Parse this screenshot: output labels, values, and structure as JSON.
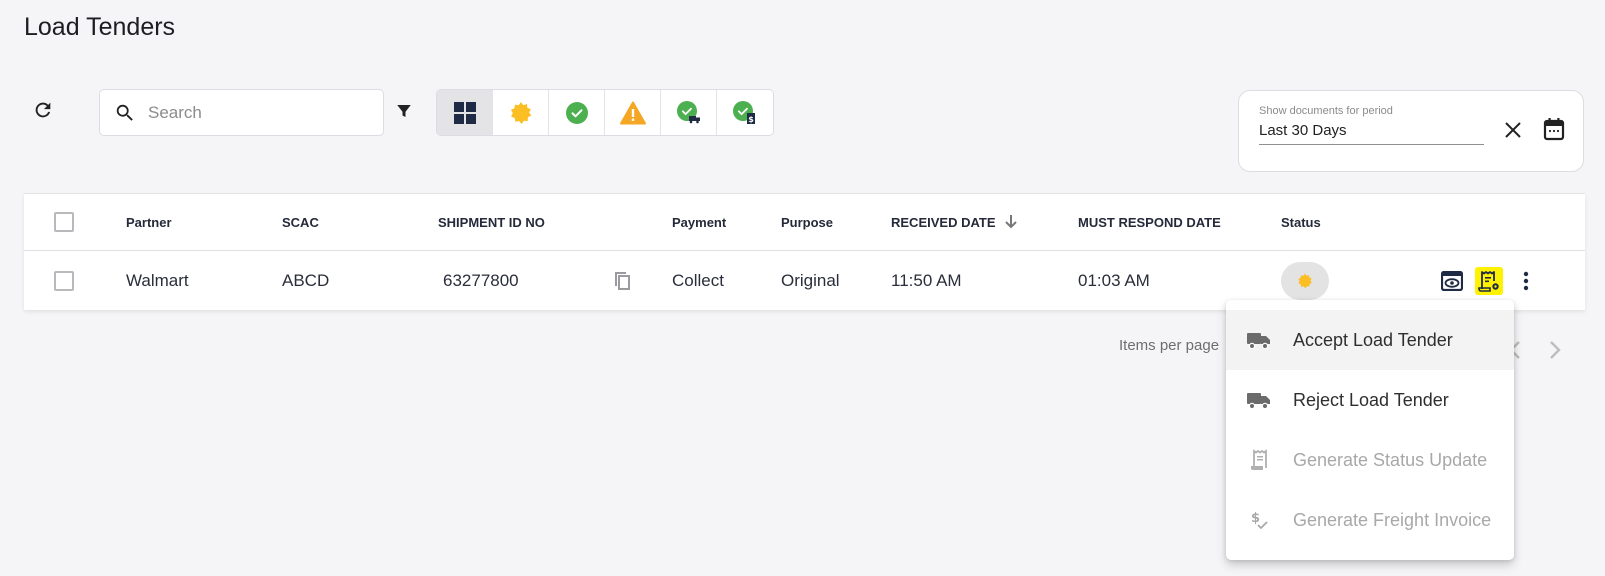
{
  "page": {
    "title": "Load Tenders"
  },
  "toolbar": {
    "refresh_icon": "refresh-icon",
    "search": {
      "placeholder": "Search",
      "value": ""
    },
    "filter_icon": "filter-icon",
    "status_filters": [
      {
        "name": "all",
        "icon": "grid-icon",
        "active": true
      },
      {
        "name": "pending",
        "icon": "pending-badge-icon",
        "color": "#fbbf24"
      },
      {
        "name": "accepted",
        "icon": "check-circle-icon",
        "color": "#4caf50"
      },
      {
        "name": "warning",
        "icon": "warning-icon",
        "color": "#f5a623"
      },
      {
        "name": "status-sent",
        "icon": "check-truck-icon",
        "color": "#4caf50"
      },
      {
        "name": "invoiced",
        "icon": "check-invoice-icon",
        "color": "#4caf50"
      }
    ]
  },
  "period": {
    "label": "Show documents for period",
    "value": "Last 30 Days"
  },
  "table": {
    "columns": [
      "Partner",
      "SCAC",
      "SHIPMENT ID NO",
      "Payment",
      "Purpose",
      "RECEIVED DATE",
      "MUST RESPOND DATE",
      "Status"
    ],
    "sort": {
      "column": "RECEIVED DATE",
      "direction": "desc"
    },
    "rows": [
      {
        "partner": "Walmart",
        "scac": "ABCD",
        "shipment_id": "63277800",
        "payment": "Collect",
        "purpose": "Original",
        "received": "11:50 AM",
        "must_respond": "01:03 AM",
        "status": "pending"
      }
    ]
  },
  "pagination": {
    "items_per_page_label": "Items per page"
  },
  "menu": {
    "items": [
      {
        "label": "Accept Load Tender",
        "icon": "truck-icon",
        "enabled": true
      },
      {
        "label": "Reject Load Tender",
        "icon": "truck-icon",
        "enabled": true
      },
      {
        "label": "Generate Status Update",
        "icon": "receipt-icon",
        "enabled": false
      },
      {
        "label": "Generate Freight Invoice",
        "icon": "dollar-check-icon",
        "enabled": false
      }
    ]
  },
  "colors": {
    "pending": "#fbbf24",
    "success": "#4caf50",
    "warning": "#f5a623",
    "highlight": "#fff200",
    "navy": "#1f2a44"
  }
}
